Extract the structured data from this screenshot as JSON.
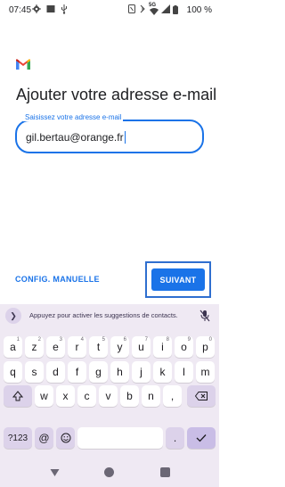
{
  "status_bar": {
    "time": "07:45",
    "battery": "100 %",
    "network": "5G",
    "left_icons": [
      "gear-icon",
      "image-icon",
      "usb-icon"
    ],
    "right_icons": [
      "nfc-icon",
      "vibrate-icon",
      "wifi-icon",
      "signal-icon",
      "battery-icon"
    ]
  },
  "logo": "gmail-logo",
  "page": {
    "title": "Ajouter votre adresse e-mail",
    "email_label": "Saisissez votre adresse e-mail",
    "email_value": "gil.bertau@orange.fr"
  },
  "actions": {
    "manual_config": "CONFIG. MANUELLE",
    "next": "SUIVANT"
  },
  "keyboard": {
    "suggestion_text": "Appuyez pour activer les suggestions de contacts.",
    "row1": [
      {
        "k": "a",
        "h": "1"
      },
      {
        "k": "z",
        "h": "2"
      },
      {
        "k": "e",
        "h": "3"
      },
      {
        "k": "r",
        "h": "4"
      },
      {
        "k": "t",
        "h": "5"
      },
      {
        "k": "y",
        "h": "6"
      },
      {
        "k": "u",
        "h": "7"
      },
      {
        "k": "i",
        "h": "8"
      },
      {
        "k": "o",
        "h": "9"
      },
      {
        "k": "p",
        "h": "0"
      }
    ],
    "row2": [
      "q",
      "s",
      "d",
      "f",
      "g",
      "h",
      "j",
      "k",
      "l",
      "m"
    ],
    "row3": [
      "w",
      "x",
      "c",
      "v",
      "b",
      "n"
    ],
    "symbols": "?123",
    "at": "@",
    "comma": ",",
    "period": ".",
    "accent_color": "#1a73e8"
  },
  "navbar": {
    "icons": [
      "back-icon",
      "home-icon",
      "recents-icon"
    ]
  }
}
